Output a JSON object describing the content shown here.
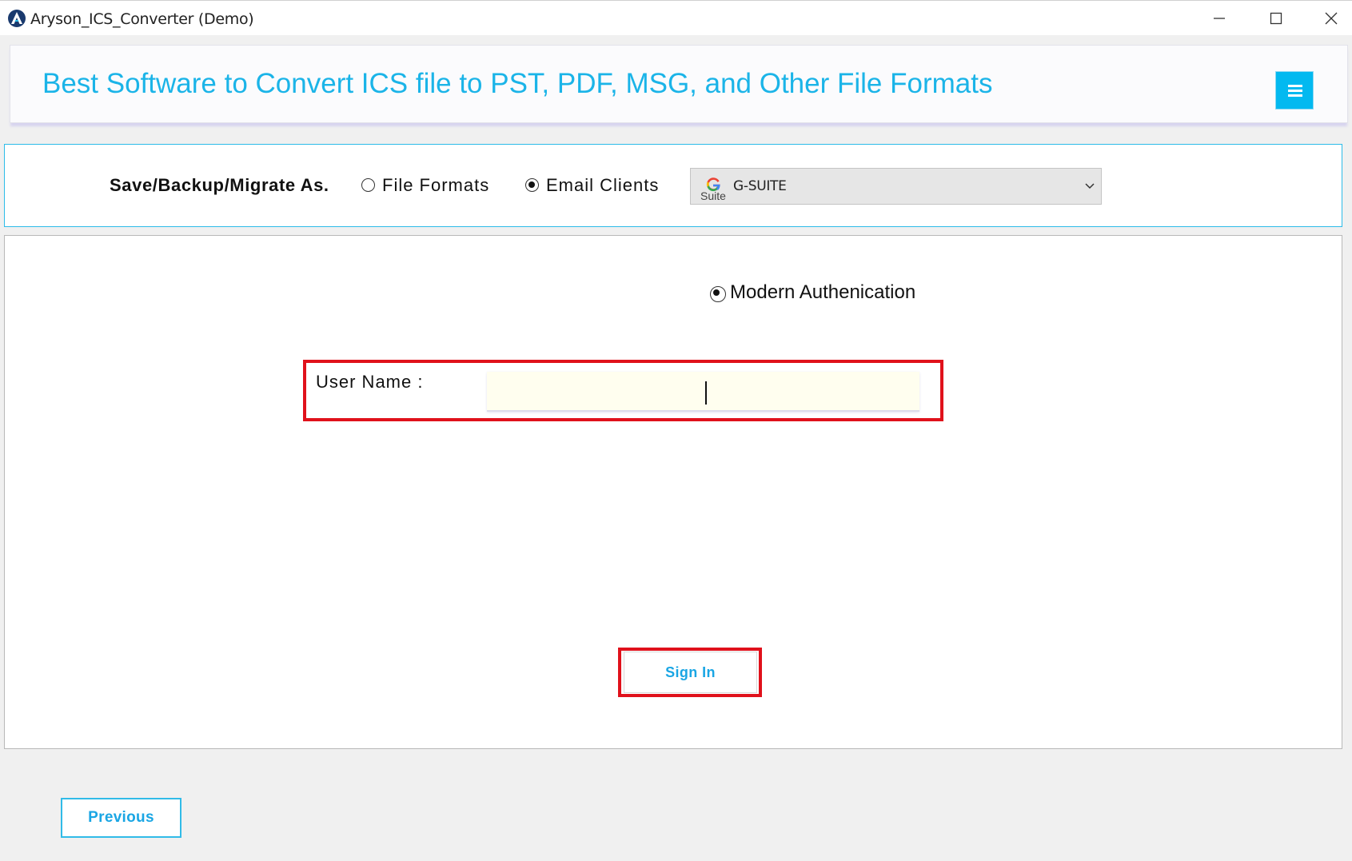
{
  "window": {
    "title": "Aryson_ICS_Converter (Demo)",
    "controls": [
      "minimize",
      "maximize",
      "close"
    ]
  },
  "header": {
    "title": "Best Software to Convert ICS file to PST, PDF, MSG, and Other File Formats",
    "menu_icon": "hamburger-menu-icon"
  },
  "save_options": {
    "label": "Save/Backup/Migrate As.",
    "options": [
      {
        "label": "File Formats",
        "selected": false
      },
      {
        "label": "Email Clients",
        "selected": true
      }
    ],
    "dropdown": {
      "logo_text": "Suite",
      "selected": "G-SUITE"
    }
  },
  "auth": {
    "option_label": "Modern Authenication",
    "selected": true
  },
  "login": {
    "user_name_label": "User Name :",
    "user_name_value": "",
    "sign_in_label": "Sign In"
  },
  "footer": {
    "previous_label": "Previous"
  },
  "colors": {
    "accent": "#1bb4e8",
    "menu_button": "#03b9f0",
    "highlight": "#e0111b",
    "input_background": "#fffeef"
  }
}
